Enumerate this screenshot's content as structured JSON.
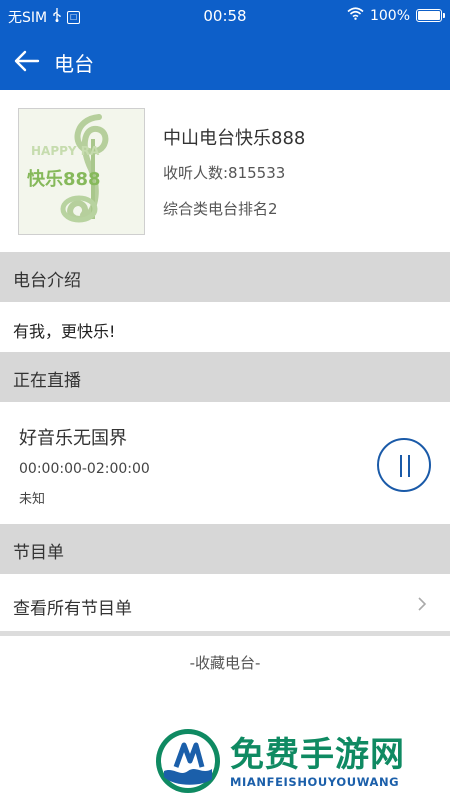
{
  "status_bar": {
    "carrier": "无SIM",
    "usb_glyph": "Ꝥ",
    "time": "00:58",
    "battery": "100%"
  },
  "header": {
    "title": "电台"
  },
  "station": {
    "cover_text_en": "HAPPY RA",
    "cover_text_cn": "快乐888",
    "name": "中山电台快乐888",
    "listeners": "收听人数:815533",
    "rank": "综合类电台排名2"
  },
  "sections": {
    "intro": "电台介绍",
    "live": "正在直播",
    "schedule": "节目单"
  },
  "intro_text": "有我，更快乐!",
  "live": {
    "program": "好音乐无国界",
    "time_range": "00:00:00-02:00:00",
    "host": "未知"
  },
  "schedule_link": "查看所有节目单",
  "favorite": "-收藏电台-",
  "watermark": {
    "cn": "免费手游网",
    "en": "MIANFEISHOUYOUWANG"
  },
  "colors": {
    "header_blue": "#0d5fc9",
    "section_gray": "#d7d7d7",
    "pause_blue": "#1a5aa8",
    "watermark_green": "#0f8a62",
    "watermark_blue": "#1b5faa"
  },
  "icons": [
    "back-arrow-icon",
    "usb-icon",
    "wifi-icon",
    "battery-icon",
    "pause-icon",
    "chevron-right-icon"
  ]
}
